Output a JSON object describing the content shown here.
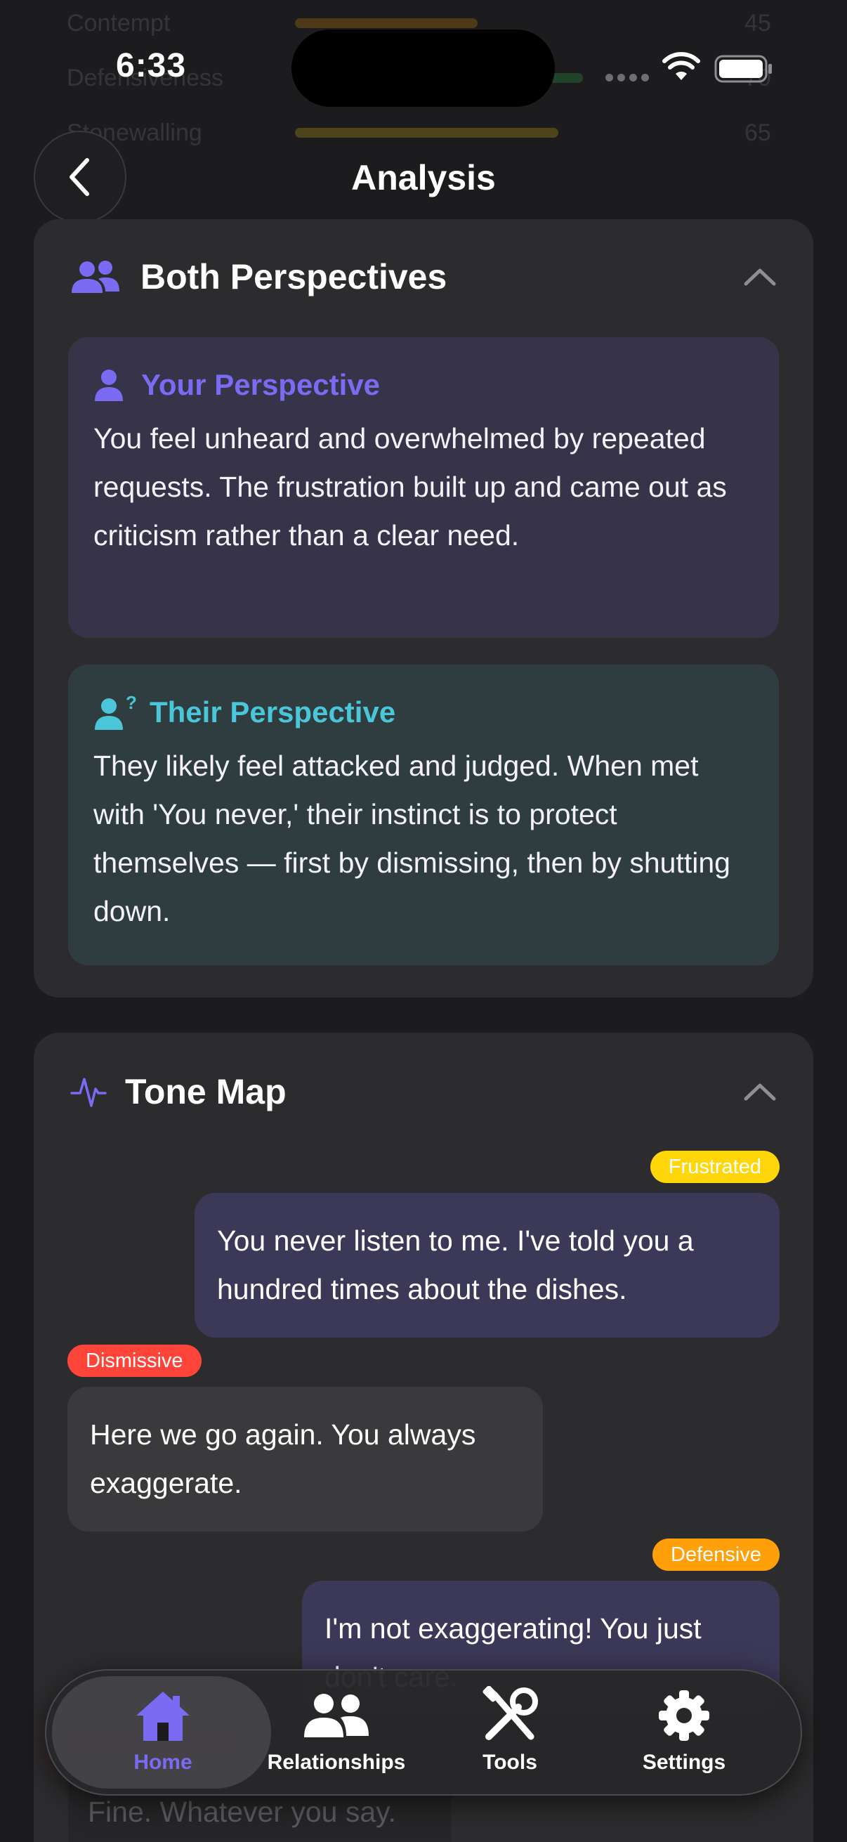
{
  "status_bar": {
    "time": "6:33"
  },
  "header": {
    "title": "Analysis"
  },
  "background_rows": [
    {
      "label": "Contempt",
      "color": "#ff9f0a",
      "value": "45"
    },
    {
      "label": "Defensiveness",
      "color": "#30d158",
      "value": "70"
    },
    {
      "label": "Stonewalling",
      "color": "#ffd60a",
      "value": "65"
    }
  ],
  "perspectives": {
    "title": "Both Perspectives",
    "yours": {
      "title": "Your Perspective",
      "text": "You feel unheard and overwhelmed by repeated requests. The frustration built up and came out as criticism rather than a clear need."
    },
    "theirs": {
      "title": "Their Perspective",
      "text": "They likely feel attacked and judged. When met with 'You never,' their instinct is to protect themselves — first by dismissing, then by shutting down."
    }
  },
  "tone_map": {
    "title": "Tone Map",
    "messages": [
      {
        "tone": "Frustrated",
        "tone_color": "#ffd60a",
        "text": "You never listen to me. I've told you a hundred times about the dishes."
      },
      {
        "tone": "Dismissive",
        "tone_color": "#ff453a",
        "text": "Here we go again. You always exaggerate."
      },
      {
        "tone": "Defensive",
        "tone_color": "#ff9f0a",
        "text": "I'm not exaggerating! You just don't care."
      },
      {
        "tone": "",
        "tone_color": "",
        "text": "Fine. Whatever you say."
      }
    ]
  },
  "colors": {
    "accent": "#7b6bf2",
    "teal": "#4ac6d8",
    "card": "#2c2c2e",
    "background": "#1c1c1e"
  },
  "tab_bar": {
    "items": [
      {
        "label": "Home",
        "icon": "house-icon",
        "active": true
      },
      {
        "label": "Relationships",
        "icon": "people-icon",
        "active": false
      },
      {
        "label": "Tools",
        "icon": "tools-icon",
        "active": false
      },
      {
        "label": "Settings",
        "icon": "gear-icon",
        "active": false
      }
    ]
  }
}
